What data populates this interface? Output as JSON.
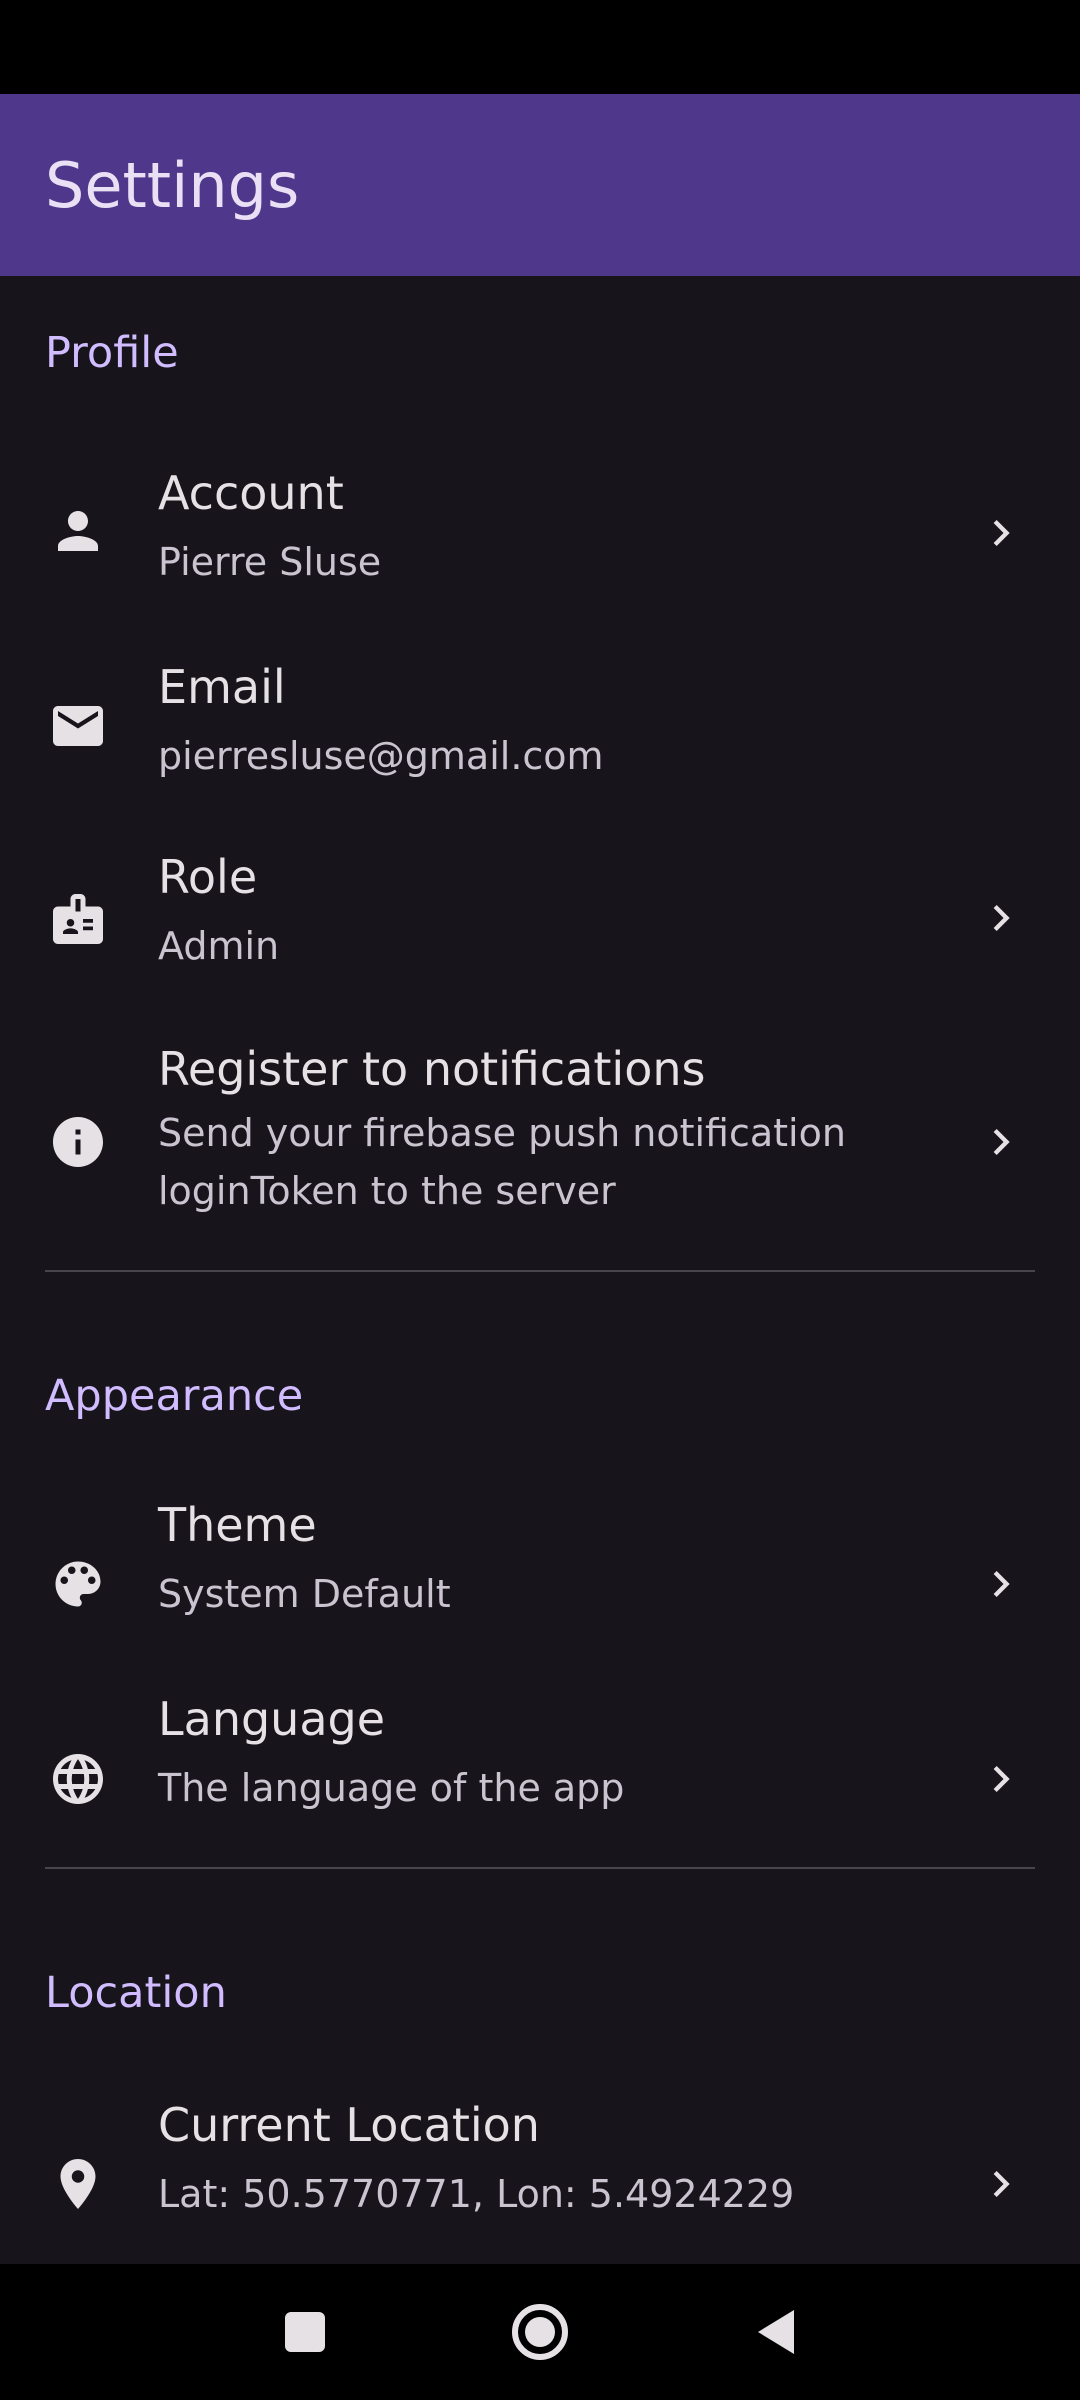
{
  "app_bar": {
    "title": "Settings",
    "color": "#4f378b"
  },
  "sections": {
    "profile": {
      "header": "Profile",
      "items": [
        {
          "title": "Account",
          "subtitle": "Pierre Sluse",
          "icon": "person-icon",
          "has_chevron": true
        },
        {
          "title": "Email",
          "subtitle": "pierresluse@gmail.com",
          "icon": "mail-icon",
          "has_chevron": false
        },
        {
          "title": "Role",
          "subtitle": "Admin",
          "icon": "badge-icon",
          "has_chevron": true
        },
        {
          "title": "Register to notifications",
          "subtitle": "Send your firebase push notification loginToken to the server",
          "icon": "info-icon",
          "has_chevron": true
        }
      ]
    },
    "appearance": {
      "header": "Appearance",
      "items": [
        {
          "title": "Theme",
          "subtitle": "System Default",
          "icon": "palette-icon",
          "has_chevron": true
        },
        {
          "title": "Language",
          "subtitle": "The language of the app",
          "icon": "globe-icon",
          "has_chevron": true
        }
      ]
    },
    "location": {
      "header": "Location",
      "items": [
        {
          "title": "Current Location",
          "subtitle": "Lat: 50.5770771, Lon: 5.4924229",
          "icon": "location-pin-icon",
          "has_chevron": true
        }
      ]
    }
  },
  "nav_bar": {
    "buttons": [
      "recents-icon",
      "home-icon",
      "back-icon"
    ]
  },
  "colors": {
    "background": "#17151b",
    "accent": "#d0bcff",
    "text": "#e6e1e5",
    "subtext": "#cac4d0"
  }
}
